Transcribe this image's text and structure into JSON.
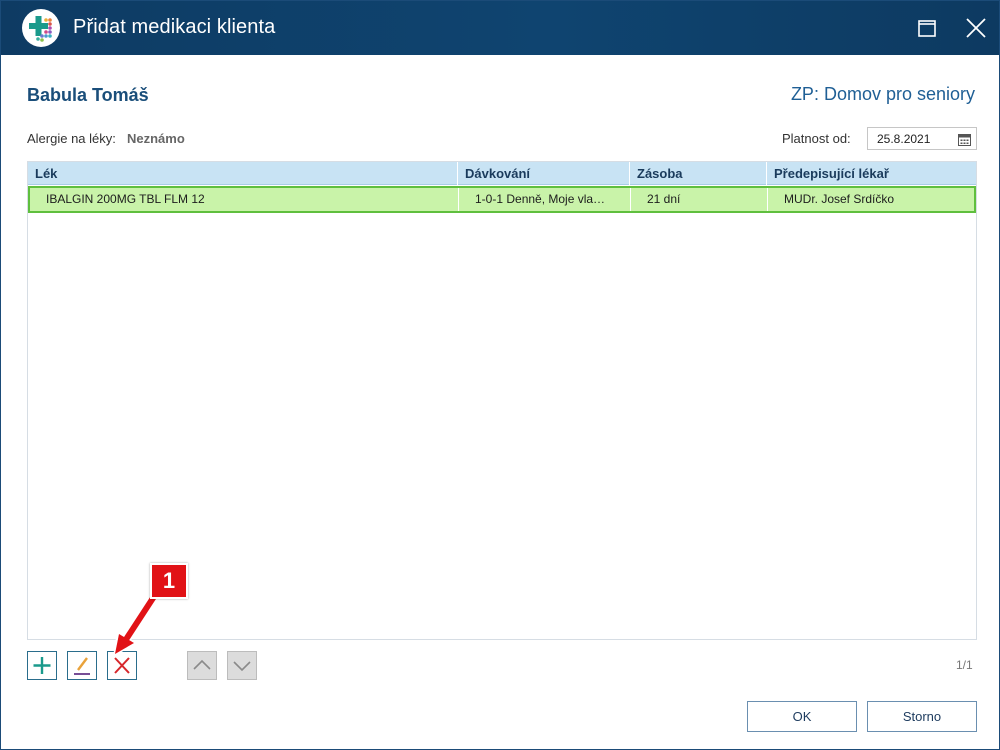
{
  "window": {
    "title": "Přidat medikaci klienta"
  },
  "client": {
    "name": "Babula Tomáš",
    "zp": "ZP: Domov pro seniory"
  },
  "allergy": {
    "label": "Alergie na léky:",
    "value": "Neznámo"
  },
  "validity": {
    "label": "Platnost od:",
    "date": "25.8.2021"
  },
  "grid": {
    "columns": [
      "Lék",
      "Dávkování",
      "Zásoba",
      "Předepisující lékař"
    ],
    "rows": [
      {
        "lek": "IBALGIN 200MG TBL FLM 12",
        "davkovani": "1-0-1 Denně, Moje vla…",
        "zasoba": "21 dní",
        "lekar": "MUDr. Josef Srdíčko"
      }
    ]
  },
  "pager": "1/1",
  "buttons": {
    "ok": "OK",
    "cancel": "Storno"
  },
  "callout": "1",
  "colors": {
    "titlebar": "#0f4470",
    "header": "#c8e3f4",
    "selected_row": "#c9f3a9",
    "accent_teal": "#1a9a8c",
    "delete_red": "#d7262b",
    "callout_red": "#e11216"
  }
}
